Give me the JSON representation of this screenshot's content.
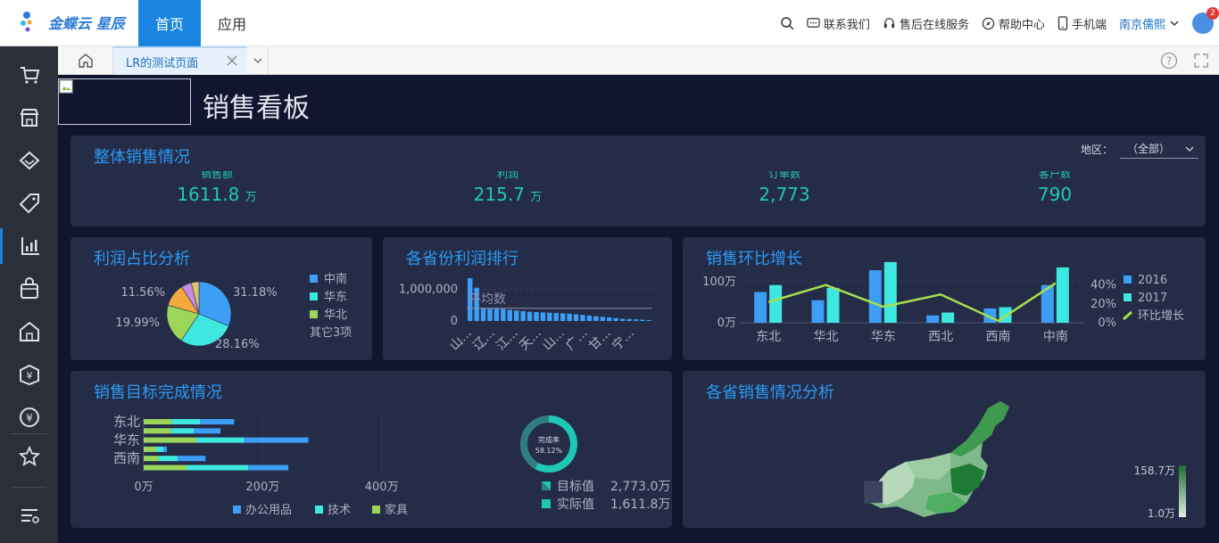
{
  "topbar": {
    "logo_text": "金蝶云 星辰",
    "nav_home": "首页",
    "nav_app": "应用",
    "contact": "联系我们",
    "after_sales": "售后在线服务",
    "help": "帮助中心",
    "mobile": "手机端",
    "user": "南京儒熙",
    "badge": "2"
  },
  "tabbar": {
    "active_tab": "LR的测试页面"
  },
  "dashboard": {
    "title": "销售看板",
    "overall": {
      "title": "整体销售情况",
      "region_label": "地区：",
      "region_value": "（全部）",
      "kpis": [
        {
          "label": "销售额",
          "value": "1611.8",
          "unit": "万"
        },
        {
          "label": "利润",
          "value": "215.7",
          "unit": "万"
        },
        {
          "label": "订单数",
          "value": "2,773",
          "unit": ""
        },
        {
          "label": "客户数",
          "value": "790",
          "unit": ""
        }
      ]
    },
    "profit_share": {
      "title": "利润占比分析"
    },
    "province_rank": {
      "title": "各省份利润排行"
    },
    "mom_growth": {
      "title": "销售环比增长"
    },
    "target": {
      "title": "销售目标完成情况"
    },
    "province_sales": {
      "title": "各省销售情况分析"
    }
  },
  "colors": {
    "blue": "#3c9ef5",
    "cyan": "#3ee8e0",
    "green": "#9bd65a",
    "orange": "#f5a83c",
    "purple": "#c28be0",
    "teal": "#1fc8b5",
    "lime": "#a6e04d"
  },
  "chart_data": [
    {
      "type": "pie",
      "title": "利润占比分析",
      "categories": [
        "中南",
        "华东",
        "华北",
        "其它3项"
      ],
      "slices": [
        {
          "name": "中南",
          "value": 31.18
        },
        {
          "name": "华东",
          "value": 28.16
        },
        {
          "name": "华北",
          "value": 19.99
        },
        {
          "name": "",
          "value": 11.56
        },
        {
          "name": "",
          "value": 5.2
        },
        {
          "name": "",
          "value": 3.91
        }
      ],
      "labels": [
        "31.18%",
        "28.16%",
        "19.99%",
        "11.56%"
      ],
      "legend": [
        "中南",
        "华东",
        "华北",
        "其它3项"
      ],
      "legend_position": "right"
    },
    {
      "type": "bar",
      "title": "各省份利润排行",
      "ytick_labels": [
        "1,000,000",
        "0"
      ],
      "x_tick_labels": [
        "山...",
        "辽...",
        "江...",
        "天...",
        "山...",
        "广...",
        "甘...",
        "宁..."
      ],
      "annotation": "平均数",
      "values": [
        1350000,
        1050000,
        420000,
        410000,
        400000,
        380000,
        350000,
        330000,
        310000,
        290000,
        280000,
        270000,
        260000,
        250000,
        240000,
        230000,
        210000,
        190000,
        170000,
        150000,
        130000,
        110000,
        90000,
        70000,
        60000,
        50000,
        40000,
        30000
      ],
      "average": 400000,
      "ylim": [
        0,
        1350000
      ]
    },
    {
      "type": "bar",
      "title": "销售环比增长",
      "categories": [
        "东北",
        "华北",
        "华东",
        "西北",
        "西南",
        "中南"
      ],
      "series": [
        {
          "name": "2016",
          "values": [
            75,
            55,
            128,
            18,
            35,
            92
          ]
        },
        {
          "name": "2017",
          "values": [
            92,
            85,
            148,
            25,
            38,
            135
          ]
        },
        {
          "name": "环比增长",
          "type": "line",
          "axis": "right",
          "values": [
            22,
            40,
            17,
            30,
            2,
            42
          ]
        }
      ],
      "ytick_labels_left": [
        "100万",
        "0万"
      ],
      "ytick_labels_right": [
        "40%",
        "20%",
        "0%"
      ],
      "ylim_left": [
        0,
        150
      ],
      "ylim_right": [
        0,
        50
      ],
      "legend": [
        "2016",
        "2017",
        "环比增长"
      ],
      "legend_position": "right"
    },
    {
      "type": "bar",
      "orientation": "horizontal",
      "stacked": true,
      "title": "销售目标完成情况",
      "categories": [
        "东北",
        "",
        "华东",
        "",
        "西南",
        ""
      ],
      "series": [
        {
          "name": "办公用品",
          "values": [
            47,
            46,
            88,
            21,
            25,
            72
          ]
        },
        {
          "name": "技术",
          "values": [
            48,
            38,
            81,
            12,
            32,
            104
          ]
        },
        {
          "name": "家具",
          "values": [
            57,
            45,
            108,
            6,
            47,
            67
          ]
        }
      ],
      "xtick_labels": [
        "0万",
        "200万",
        "400万"
      ],
      "xlim": [
        0,
        450
      ],
      "legend": [
        "办公用品",
        "技术",
        "家具"
      ],
      "legend_position": "bottom"
    },
    {
      "type": "pie",
      "subtype": "donut",
      "title": "完成率",
      "center_label": "完成率",
      "center_value": "58.12%",
      "completion": 0.5812,
      "target_label": "目标值",
      "target_value": "2,773.0万",
      "actual_label": "实际值",
      "actual_value": "1,611.8万"
    },
    {
      "type": "heatmap",
      "subtype": "choropleth",
      "title": "各省销售情况分析",
      "scale_max_label": "158.7万",
      "scale_min_label": "1.0万"
    }
  ]
}
